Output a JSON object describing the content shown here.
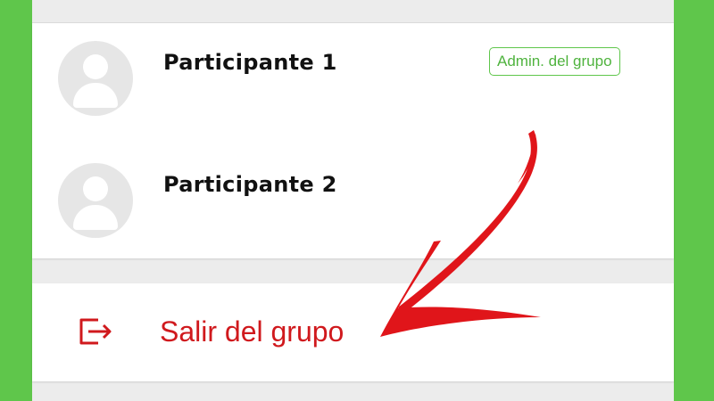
{
  "participants": [
    {
      "name": "Participante 1",
      "badge": "Admin. del grupo"
    },
    {
      "name": "Participante 2"
    }
  ],
  "exit_action": {
    "label": "Salir del grupo",
    "icon": "exit-icon"
  },
  "colors": {
    "frame_green": "#5fc64b",
    "badge_green": "#4fb33e",
    "exit_red": "#d0191d",
    "arrow_red": "#e0151a"
  }
}
